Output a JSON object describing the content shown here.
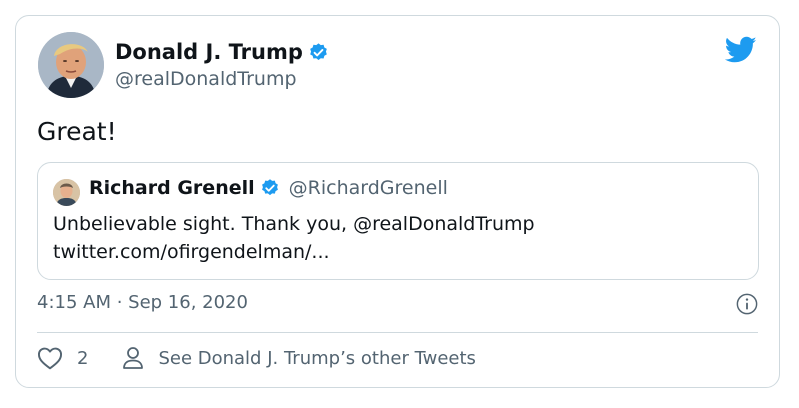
{
  "author": {
    "name": "Donald J. Trump",
    "handle": "@realDonaldTrump"
  },
  "tweet": {
    "text": "Great!",
    "timestamp": "4:15 AM · Sep 16, 2020"
  },
  "quoted": {
    "name": "Richard Grenell",
    "handle": "@RichardGrenell",
    "line1": "Unbelievable sight. Thank you, @realDonaldTrump",
    "line2": "twitter.com/ofirgendelman/..."
  },
  "actions": {
    "like_count": "2",
    "other_tweets_label": "See Donald J. Trump’s other Tweets"
  },
  "colors": {
    "brand": "#1d9bf0",
    "border": "#cfd9de",
    "muted": "#536471"
  },
  "icons": [
    "verified-badge-icon",
    "twitter-bird-icon",
    "info-icon",
    "heart-icon",
    "person-icon"
  ]
}
